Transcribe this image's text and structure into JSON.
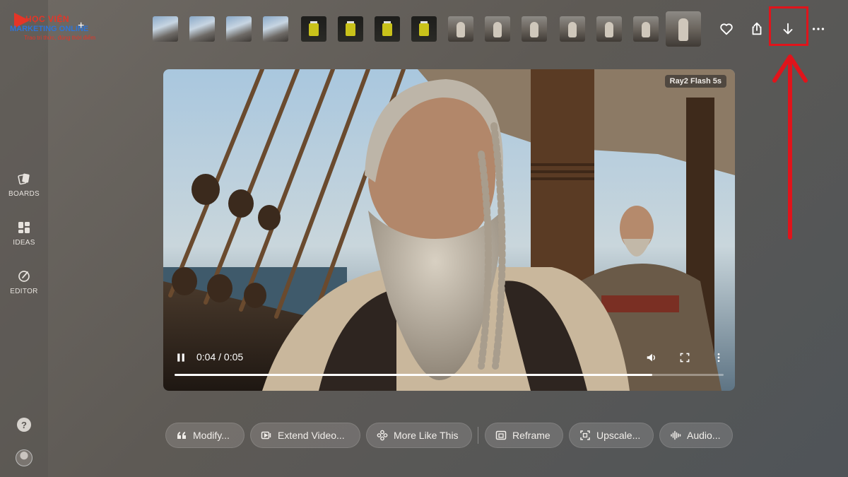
{
  "branding": {
    "line1": "HỌC VIỆN",
    "line2": "MARKETING ONLINE",
    "line3": "Trao tri thức, đúng thời điểm",
    "plus": "+"
  },
  "sidebar": {
    "items": [
      {
        "label": "BOARDS",
        "icon": "boards-icon"
      },
      {
        "label": "IDEAS",
        "icon": "ideas-icon"
      },
      {
        "label": "EDITOR",
        "icon": "editor-icon"
      }
    ],
    "help": "?"
  },
  "thumbnails": {
    "count": 15,
    "selected_index": 14
  },
  "top_actions": [
    "heart-icon",
    "share-icon",
    "download-icon",
    "more-icon"
  ],
  "player": {
    "badge": "Ray2 Flash  5s",
    "time": "0:04 / 0:05",
    "progress": 0.87,
    "playing": true
  },
  "actions": [
    {
      "label": "Modify...",
      "icon": "quote-icon"
    },
    {
      "label": "Extend Video...",
      "icon": "extend-icon"
    },
    {
      "label": "More Like This",
      "icon": "sparkle-icon"
    },
    {
      "label": "Reframe",
      "icon": "reframe-icon"
    },
    {
      "label": "Upscale...",
      "icon": "upscale-icon"
    },
    {
      "label": "Audio...",
      "icon": "audio-icon"
    }
  ],
  "colors": {
    "annotation": "#e0141b",
    "brand_red": "#e53527",
    "brand_blue": "#2e74d6"
  }
}
